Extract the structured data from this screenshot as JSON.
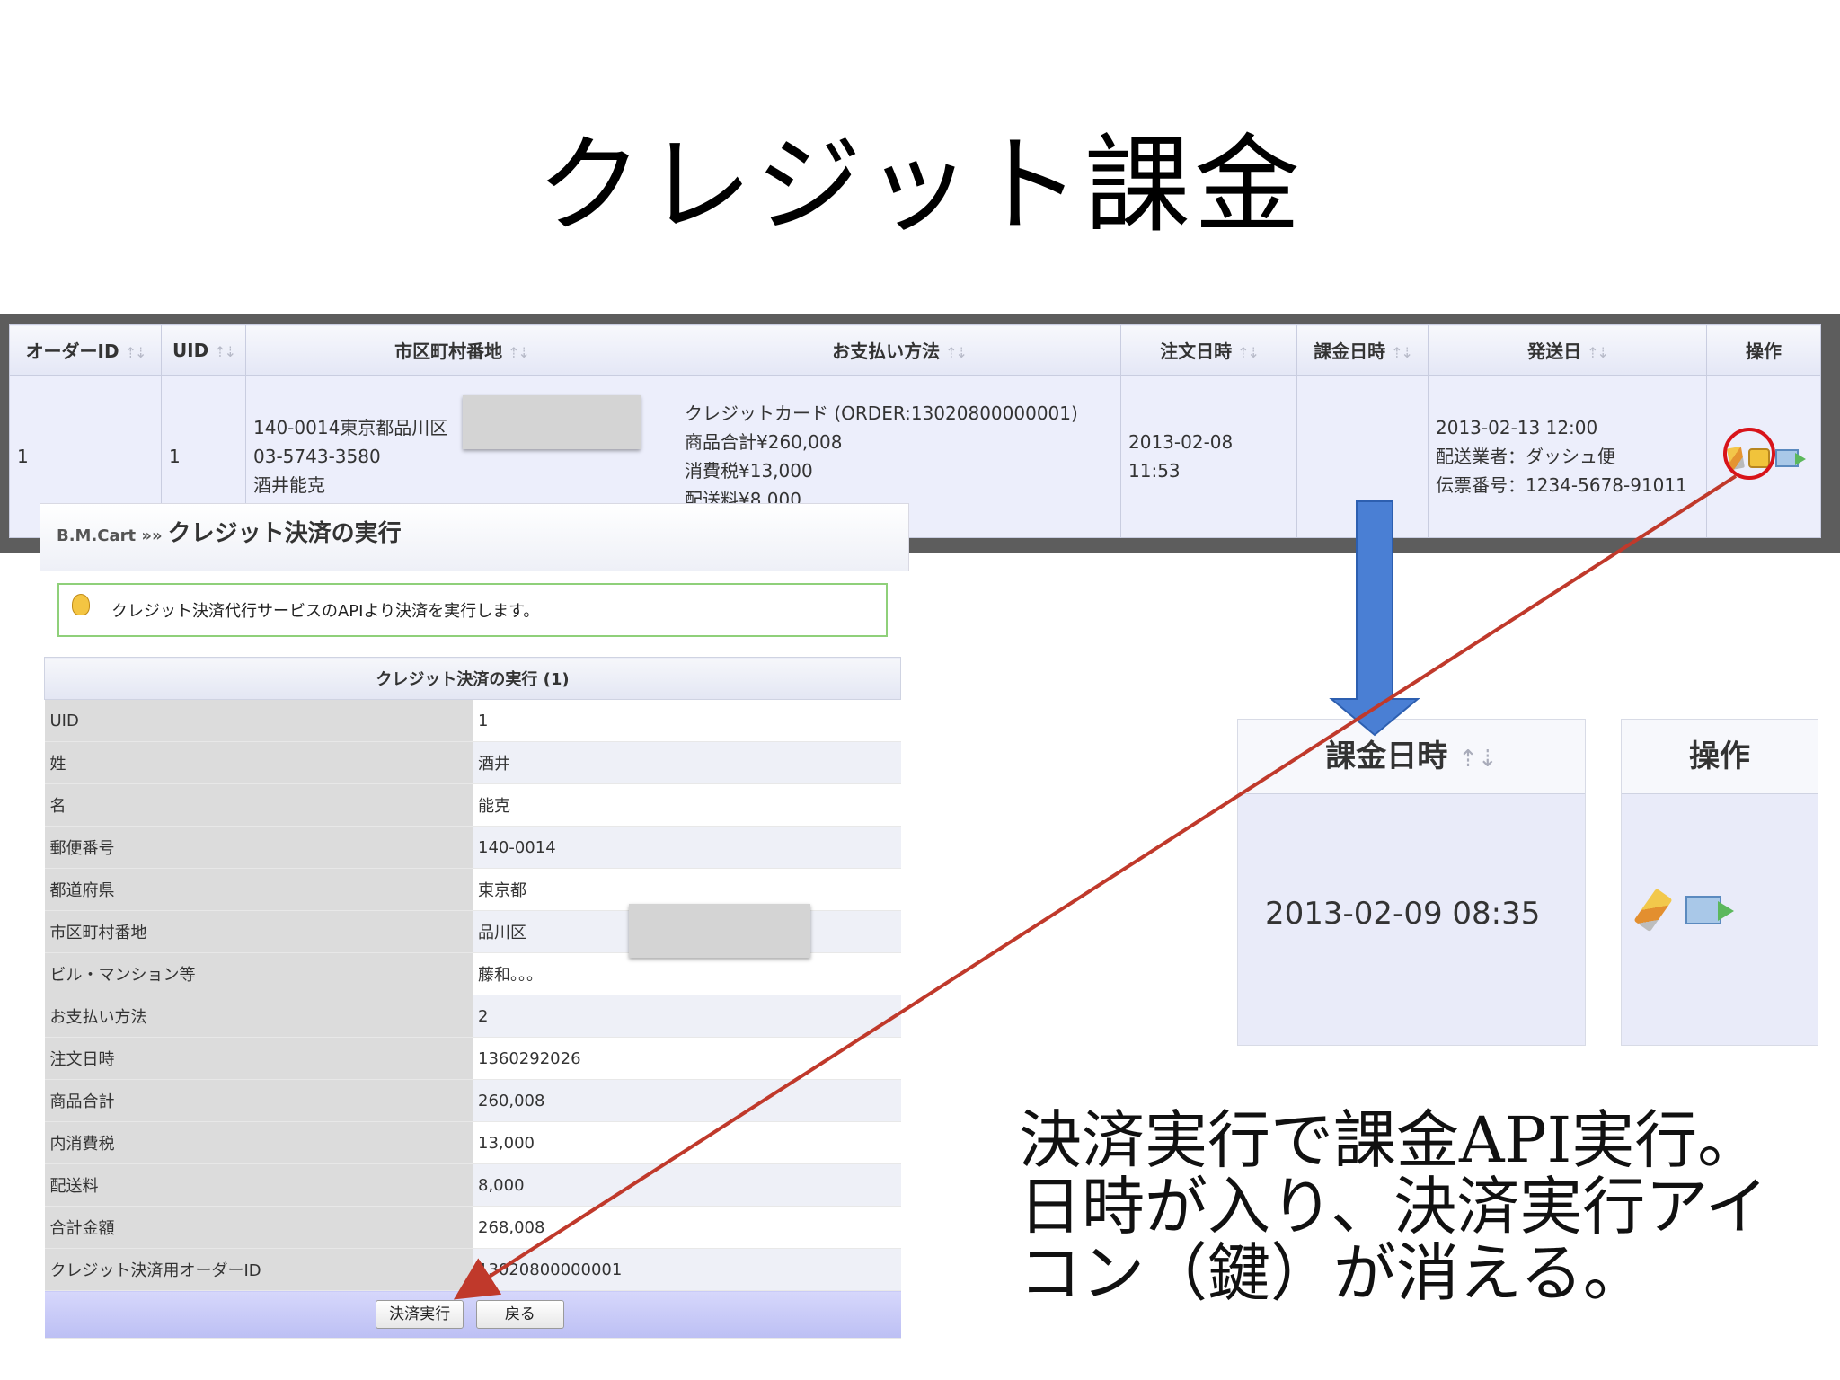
{
  "slide": {
    "title": "クレジット課金",
    "caption": "決済実行で課金API実行。日時が入り、決済実行アイコン（鍵）が消える。"
  },
  "orders": {
    "columns": [
      "オーダーID",
      "UID",
      "市区町村番地",
      "お支払い方法",
      "注文日時",
      "課金日時",
      "発送日",
      "操作"
    ],
    "row": {
      "order_id": "1",
      "uid": "1",
      "address_lines": [
        "140-0014東京都品川区",
        "03-5743-3580",
        "酒井能克"
      ],
      "payment_lines": [
        "クレジットカード (ORDER:13020800000001)",
        "商品合計¥260,008",
        "消費税¥13,000",
        "配送料¥8,000"
      ],
      "order_date": "2013-02-08 11:53",
      "charge_date": "",
      "ship_lines": [
        "2013-02-13 12:00",
        "配送業者：ダッシュ便",
        "伝票番号：1234-5678-91011"
      ],
      "ops_icons": [
        "pencil-icon",
        "lock-icon",
        "mail-icon"
      ]
    }
  },
  "panel": {
    "crumb": "B.M.Cart »»",
    "title": "クレジット決済の実行",
    "info": "クレジット決済代行サービスのAPIより決済を実行します。",
    "form_title": "クレジット決済の実行 (1)",
    "fields": [
      {
        "label": "UID",
        "value": "1"
      },
      {
        "label": "姓",
        "value": "酒井"
      },
      {
        "label": "名",
        "value": "能克"
      },
      {
        "label": "郵便番号",
        "value": "140-0014"
      },
      {
        "label": "都道府県",
        "value": "東京都"
      },
      {
        "label": "市区町村番地",
        "value": "品川区"
      },
      {
        "label": "ビル・マンション等",
        "value": "藤和。。。"
      },
      {
        "label": "お支払い方法",
        "value": "2"
      },
      {
        "label": "注文日時",
        "value": "1360292026"
      },
      {
        "label": "商品合計",
        "value": "260,008"
      },
      {
        "label": "内消費税",
        "value": "13,000"
      },
      {
        "label": "配送料",
        "value": "8,000"
      },
      {
        "label": "合計金額",
        "value": "268,008"
      },
      {
        "label": "クレジット決済用オーダーID",
        "value": "13020800000001"
      }
    ],
    "execute_button": "決済実行",
    "back_button": "戻る"
  },
  "zoom": {
    "charge_header": "課金日時",
    "charge_value": "2013-02-09 08:35",
    "ops_header": "操作"
  },
  "colors": {
    "highlight_circle": "#d8141a",
    "arrow_line": "#c0392b",
    "down_arrow": "#4a7fd4"
  }
}
